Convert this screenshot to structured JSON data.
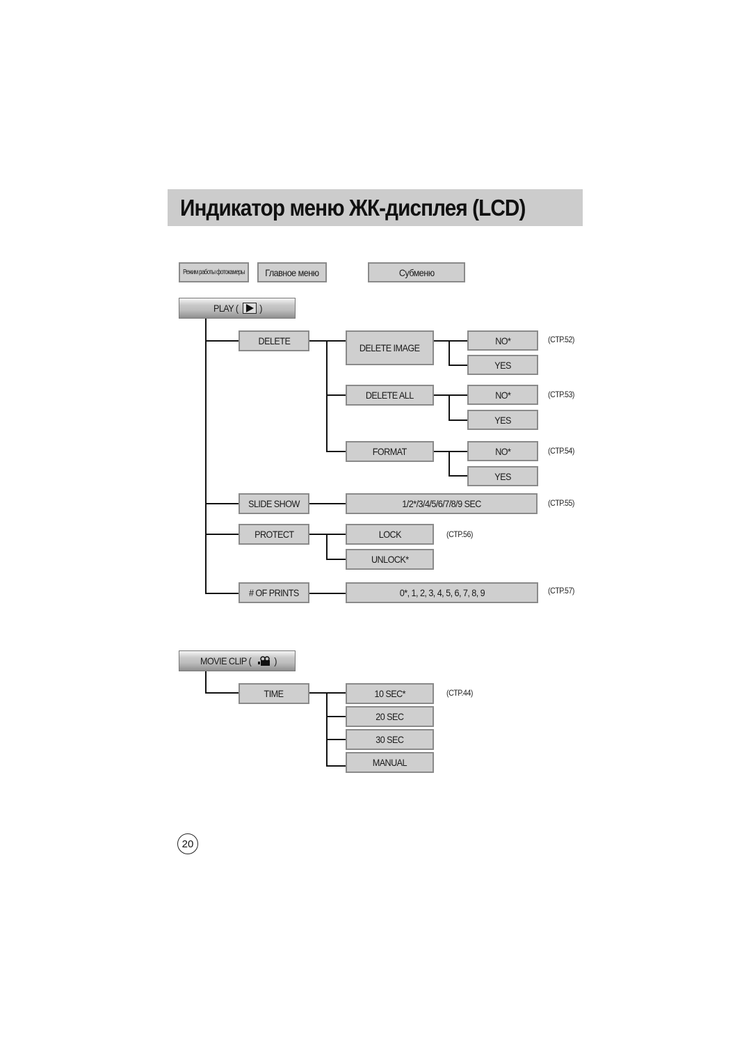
{
  "header": {
    "title": "Индикатор меню ЖК-дисплея (LCD)"
  },
  "legend": {
    "camera_mode": "Режим работы фотокамеры",
    "main_menu": "Главное меню",
    "submenu": "Субменю"
  },
  "play": {
    "label_prefix": "PLAY (",
    "label_suffix": ")",
    "icon": "play-icon",
    "menus": {
      "delete": {
        "label": "DELETE",
        "delete_image": {
          "label": "DELETE IMAGE",
          "options": [
            "NO*",
            "YES"
          ],
          "ref": "(CTP.52)"
        },
        "delete_all": {
          "label": "DELETE ALL",
          "options": [
            "NO*",
            "YES"
          ],
          "ref": "(CTP.53)"
        },
        "format": {
          "label": "FORMAT",
          "options": [
            "NO*",
            "YES"
          ],
          "ref": "(CTP.54)"
        }
      },
      "slide_show": {
        "label": "SLIDE SHOW",
        "value": "1/2*/3/4/5/6/7/8/9 SEC",
        "ref": "(CTP.55)"
      },
      "protect": {
        "label": "PROTECT",
        "options": [
          "LOCK",
          "UNLOCK*"
        ],
        "ref": "(CTP.56)"
      },
      "prints": {
        "label": "# OF PRINTS",
        "value": "0*, 1, 2, 3, 4, 5, 6, 7, 8, 9",
        "ref": "(CTP.57)"
      }
    }
  },
  "movie": {
    "label_prefix": "MOVIE CLIP (",
    "label_suffix": ")",
    "icon": "movie-camera-icon",
    "time": {
      "label": "TIME",
      "options": [
        "10 SEC*",
        "20 SEC",
        "30 SEC",
        "MANUAL"
      ],
      "ref": "(CTP.44)"
    }
  },
  "page_number": "20"
}
